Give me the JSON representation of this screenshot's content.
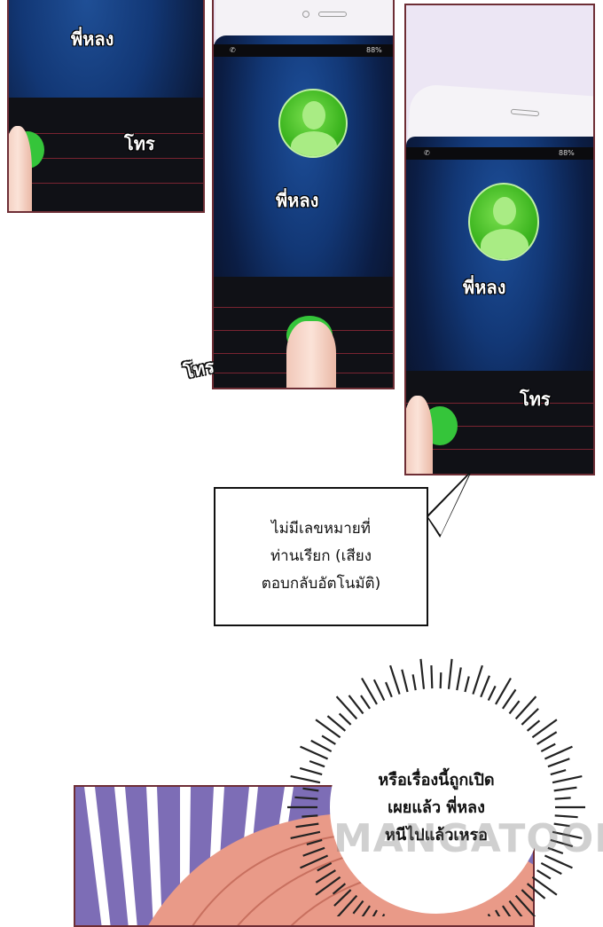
{
  "panel1": {
    "caller_name": "พี่หลง",
    "sfx": "โทร"
  },
  "panel2": {
    "caller_name": "พี่หลง",
    "sfx": "โทร",
    "battery": "88%"
  },
  "panel3": {
    "caller_name": "พี่หลง",
    "sfx": "โทร",
    "battery": "88%"
  },
  "speech_box": {
    "lines": [
      "ไม่มีเลขหมายที่",
      "ท่านเรียก (เสียง",
      "ตอบกลับอัตโนมัติ)"
    ]
  },
  "thought_bubble": {
    "lines": [
      "หรือเรื่องนี้ถูกเปิด",
      "เผยแล้ว พี่หลง",
      "หนีไปแล้วเหรอ"
    ]
  },
  "watermark": "MANGATOON",
  "colors": {
    "panel_border": "#6e2e35",
    "avatar_green": "#3cb51f",
    "screen_blue": "#123775"
  }
}
